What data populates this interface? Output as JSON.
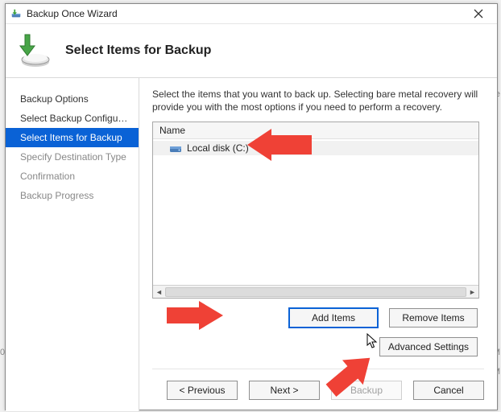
{
  "window": {
    "title": "Backup Once Wizard",
    "heading": "Select Items for Backup"
  },
  "steps": [
    {
      "label": "Backup Options",
      "state": "normal"
    },
    {
      "label": "Select Backup Configurat...",
      "state": "normal"
    },
    {
      "label": "Select Items for Backup",
      "state": "selected"
    },
    {
      "label": "Specify Destination Type",
      "state": "dim"
    },
    {
      "label": "Confirmation",
      "state": "dim"
    },
    {
      "label": "Backup Progress",
      "state": "dim"
    }
  ],
  "main": {
    "instructions": "Select the items that you want to back up. Selecting bare metal recovery will provide you with the most options if you need to perform a recovery.",
    "list_header": "Name",
    "items": [
      {
        "label": "Local disk (C:)"
      }
    ],
    "buttons": {
      "add": "Add Items",
      "remove": "Remove Items",
      "advanced": "Advanced Settings"
    }
  },
  "nav": {
    "prev": "< Previous",
    "next": "Next >",
    "backup": "Backup",
    "cancel": "Cancel"
  }
}
